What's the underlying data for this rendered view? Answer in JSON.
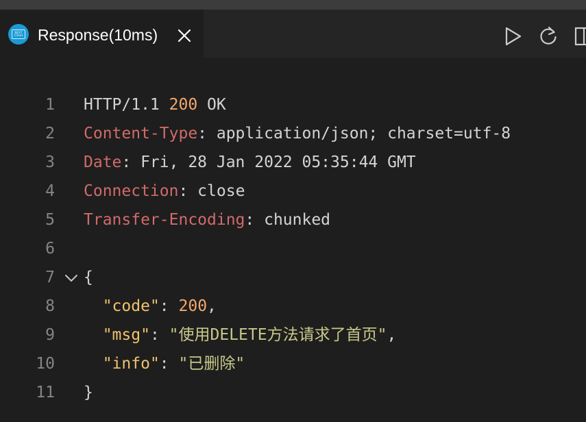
{
  "tab": {
    "icon": "rest-client-icon",
    "icon_text_top": "REST",
    "icon_text_bottom": "Client",
    "title": "Response(10ms)",
    "close_icon": "close-icon"
  },
  "actions": [
    {
      "name": "run-icon"
    },
    {
      "name": "refresh-icon"
    },
    {
      "name": "split-editor-icon"
    }
  ],
  "editor": {
    "lines": [
      {
        "num": "1",
        "parts": [
          {
            "t": "HTTP/1.1 ",
            "c": "plain"
          },
          {
            "t": "200",
            "c": "num"
          },
          {
            "t": " OK",
            "c": "plain"
          }
        ]
      },
      {
        "num": "2",
        "parts": [
          {
            "t": "Content-Type",
            "c": "header"
          },
          {
            "t": ": application/json; charset=utf-8",
            "c": "plain"
          }
        ]
      },
      {
        "num": "3",
        "parts": [
          {
            "t": "Date",
            "c": "header"
          },
          {
            "t": ": Fri, 28 Jan 2022 05:35:44 GMT",
            "c": "plain"
          }
        ]
      },
      {
        "num": "4",
        "parts": [
          {
            "t": "Connection",
            "c": "header"
          },
          {
            "t": ": close",
            "c": "plain"
          }
        ]
      },
      {
        "num": "5",
        "parts": [
          {
            "t": "Transfer-Encoding",
            "c": "header"
          },
          {
            "t": ": chunked",
            "c": "plain"
          }
        ]
      },
      {
        "num": "6",
        "parts": []
      },
      {
        "num": "7",
        "fold": true,
        "parts": [
          {
            "t": "{",
            "c": "plain"
          }
        ]
      },
      {
        "num": "8",
        "parts": [
          {
            "t": "  ",
            "c": "plain"
          },
          {
            "t": "\"code\"",
            "c": "key"
          },
          {
            "t": ": ",
            "c": "plain"
          },
          {
            "t": "200",
            "c": "num"
          },
          {
            "t": ",",
            "c": "plain"
          }
        ]
      },
      {
        "num": "9",
        "parts": [
          {
            "t": "  ",
            "c": "plain"
          },
          {
            "t": "\"msg\"",
            "c": "key"
          },
          {
            "t": ": ",
            "c": "plain"
          },
          {
            "t": "\"使用DELETE方法请求了首页\"",
            "c": "str"
          },
          {
            "t": ",",
            "c": "plain"
          }
        ]
      },
      {
        "num": "10",
        "parts": [
          {
            "t": "  ",
            "c": "plain"
          },
          {
            "t": "\"info\"",
            "c": "key"
          },
          {
            "t": ": ",
            "c": "plain"
          },
          {
            "t": "\"已删除\"",
            "c": "str"
          }
        ]
      },
      {
        "num": "11",
        "parts": [
          {
            "t": "}",
            "c": "plain"
          }
        ]
      }
    ]
  },
  "colors": {
    "background": "#1e1e1e",
    "tabbar": "#252526",
    "line_number": "#858585",
    "header_name": "#d26a6a",
    "number": "#f5a86b",
    "json_key": "#f0c36b",
    "json_string": "#c8c88b"
  }
}
